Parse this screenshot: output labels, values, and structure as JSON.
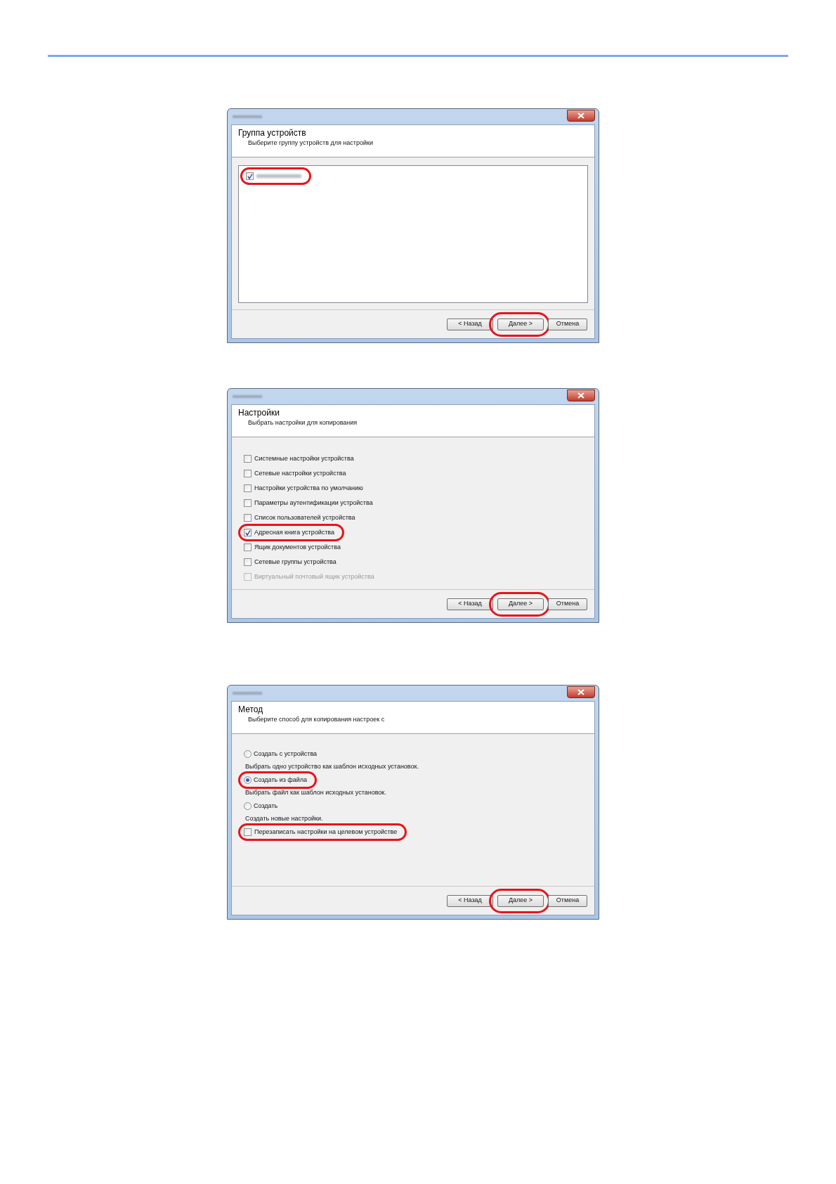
{
  "dialogs": [
    {
      "kind": "listbox",
      "heading": "Группа устройств",
      "subtitle": "Выберите группу устройств для настройки",
      "items": [
        {
          "kind": "checkbox",
          "checked": true,
          "disabled": false,
          "highlighted": true
        }
      ],
      "buttons": [
        {
          "label": "< Назад",
          "highlighted": false
        },
        {
          "label": "Далее >",
          "highlighted": true
        },
        {
          "label": "Отмена",
          "highlighted": false
        }
      ]
    },
    {
      "kind": "panel",
      "heading": "Настройки",
      "subtitle": "Выбрать настройки для копирования",
      "items": [
        {
          "kind": "checkbox",
          "label": "Системные настройки устройства",
          "checked": false,
          "disabled": false,
          "highlighted": false
        },
        {
          "kind": "checkbox",
          "label": "Сетевые настройки устройства",
          "checked": false,
          "disabled": false,
          "highlighted": false
        },
        {
          "kind": "checkbox",
          "label": "Настройки устройства по умолчанию",
          "checked": false,
          "disabled": false,
          "highlighted": false
        },
        {
          "kind": "checkbox",
          "label": "Параметры аутентификации устройства",
          "checked": false,
          "disabled": false,
          "highlighted": false
        },
        {
          "kind": "checkbox",
          "label": "Список пользователей устройства",
          "checked": false,
          "disabled": false,
          "highlighted": false
        },
        {
          "kind": "checkbox",
          "label": "Адресная книга устройства",
          "checked": true,
          "disabled": false,
          "highlighted": true
        },
        {
          "kind": "checkbox",
          "label": "Ящик документов устройства",
          "checked": false,
          "disabled": false,
          "highlighted": false
        },
        {
          "kind": "checkbox",
          "label": "Сетевые группы устройства",
          "checked": false,
          "disabled": false,
          "highlighted": false
        },
        {
          "kind": "checkbox",
          "label": "Виртуальный почтовый ящик устройства",
          "checked": false,
          "disabled": true,
          "highlighted": false
        }
      ],
      "buttons": [
        {
          "label": "< Назад",
          "highlighted": false
        },
        {
          "label": "Далее >",
          "highlighted": true
        },
        {
          "label": "Отмена",
          "highlighted": false
        }
      ]
    },
    {
      "kind": "panel",
      "heading": "Метод",
      "subtitle": "Выберите способ для копирования настроек с",
      "items": [
        {
          "kind": "radio",
          "label": "Создать с устройства",
          "selected": false,
          "highlighted": false
        },
        {
          "kind": "note",
          "label": "Выбрать одно устройство как шаблон исходных установок."
        },
        {
          "kind": "radio",
          "label": "Создать из файла",
          "selected": true,
          "highlighted": true
        },
        {
          "kind": "note",
          "label": "Выбрать файл как шаблон исходных установок."
        },
        {
          "kind": "radio",
          "label": "Создать",
          "selected": false,
          "highlighted": false
        },
        {
          "kind": "note",
          "label": "Создать новые настройки."
        },
        {
          "kind": "checkbox",
          "label": "Перезаписать настройки на целевом устройстве",
          "checked": false,
          "disabled": false,
          "highlighted": true
        }
      ],
      "buttons": [
        {
          "label": "< Назад",
          "highlighted": false
        },
        {
          "label": "Далее >",
          "highlighted": true
        },
        {
          "label": "Отмена",
          "highlighted": false
        }
      ]
    }
  ]
}
